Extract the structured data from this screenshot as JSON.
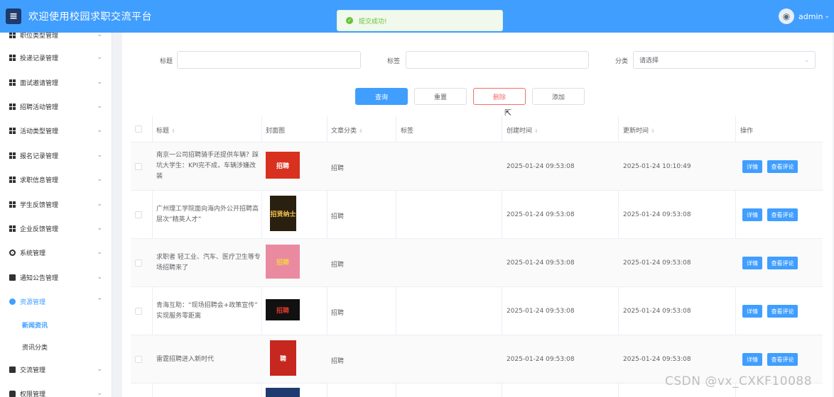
{
  "header": {
    "menu_icon": "hamburger-icon",
    "title": "欢迎使用校园求职交流平台",
    "username": "admin"
  },
  "toast": {
    "text": "提交成功!",
    "color": "#67c23a"
  },
  "sidebar": {
    "items": [
      {
        "label": "职位类型管理",
        "icon": "grid-icon"
      },
      {
        "label": "投递记录管理",
        "icon": "grid-icon"
      },
      {
        "label": "面试邀请管理",
        "icon": "grid-icon"
      },
      {
        "label": "招聘活动管理",
        "icon": "grid-icon"
      },
      {
        "label": "活动类型管理",
        "icon": "grid-icon"
      },
      {
        "label": "报名记录管理",
        "icon": "grid-icon"
      },
      {
        "label": "求职信息管理",
        "icon": "grid-icon"
      },
      {
        "label": "学生反馈管理",
        "icon": "grid-icon"
      },
      {
        "label": "企业反馈管理",
        "icon": "grid-icon"
      },
      {
        "label": "系统管理",
        "icon": "gear-icon"
      },
      {
        "label": "通知公告管理",
        "icon": "document-icon"
      },
      {
        "label": "资源管理",
        "icon": "plus-circle-icon"
      },
      {
        "label": "交流管理",
        "icon": "chat-icon"
      },
      {
        "label": "权限管理",
        "icon": "lock-icon"
      }
    ],
    "sub_items": [
      {
        "label": "新闻资讯"
      },
      {
        "label": "资讯分类"
      }
    ]
  },
  "search": {
    "title_label": "标题",
    "tag_label": "标签",
    "category_label": "分类",
    "category_placeholder": "请选择"
  },
  "buttons": {
    "query": "查询",
    "reset": "重置",
    "delete": "删除",
    "add": "添加"
  },
  "table": {
    "headers": [
      "标题",
      "封面图",
      "文章分类",
      "标签",
      "创建时间",
      "更新时间",
      "操作"
    ],
    "rows": [
      {
        "title": "南京一公司招聘骑手还提供车辆？踩坑大学生：KPI完不成，车辆涉嫌改装",
        "category": "招聘",
        "tag": "",
        "created": "2025-01-24 09:53:08",
        "updated": "2025-01-24 10:10:49",
        "cover": "招聘"
      },
      {
        "title": "广州理工学院面向海内外公开招聘高层次“精英人才”",
        "category": "招聘",
        "tag": "",
        "created": "2025-01-24 09:53:08",
        "updated": "2025-01-24 09:53:08",
        "cover": "招贤纳士"
      },
      {
        "title": "求职者 轻工业、汽车、医疗卫生等专场招聘来了",
        "category": "招聘",
        "tag": "",
        "created": "2025-01-24 09:53:08",
        "updated": "2025-01-24 09:53:08",
        "cover": "招聘"
      },
      {
        "title": "青海互助：“现场招聘会+政策宣传” 实现服务零距离",
        "category": "招聘",
        "tag": "",
        "created": "2025-01-24 09:53:08",
        "updated": "2025-01-24 09:53:08",
        "cover": "招聘"
      },
      {
        "title": "雷霆招聘进入新时代",
        "category": "招聘",
        "tag": "",
        "created": "2025-01-24 09:53:08",
        "updated": "2025-01-24 09:53:08",
        "cover": "聘"
      }
    ],
    "detail_label": "详情",
    "comments_label": "查看评论"
  },
  "watermark": "CSDN @vx_CXKF10088"
}
